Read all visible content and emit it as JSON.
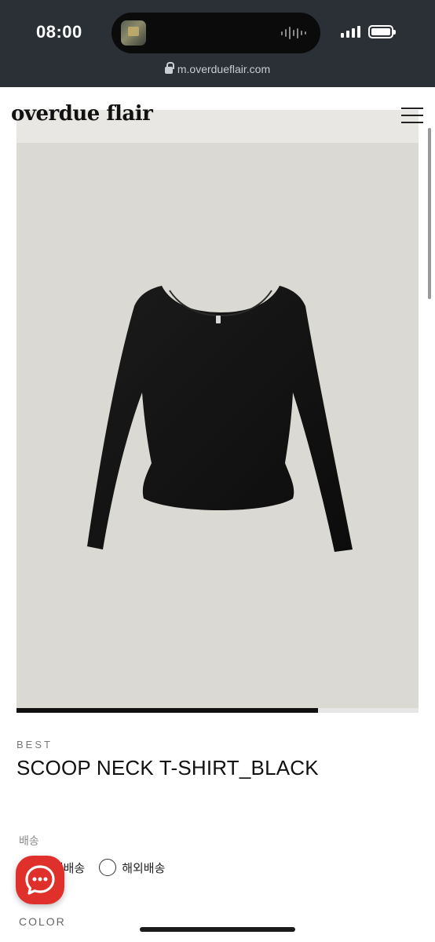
{
  "status_bar": {
    "time": "08:00"
  },
  "browser": {
    "url": "m.overdueflair.com"
  },
  "site": {
    "logo": "overdue flair"
  },
  "product": {
    "badge": "BEST",
    "title": "SCOOP NECK T-SHIRT_BLACK",
    "image_progress": 0.75
  },
  "shipping": {
    "label": "배송",
    "options": [
      {
        "label": "국내배송",
        "selected": false
      },
      {
        "label": "해외배송",
        "selected": false
      }
    ]
  },
  "color_section": {
    "label": "COLOR"
  },
  "colors": {
    "topbar": "#2b2f36",
    "photo_background": "#dbd9d4",
    "chat_button": "#e0302b",
    "garment": "#111111"
  },
  "icons": [
    "lock-icon",
    "signal-icon",
    "battery-icon",
    "menu-icon",
    "chat-icon"
  ]
}
